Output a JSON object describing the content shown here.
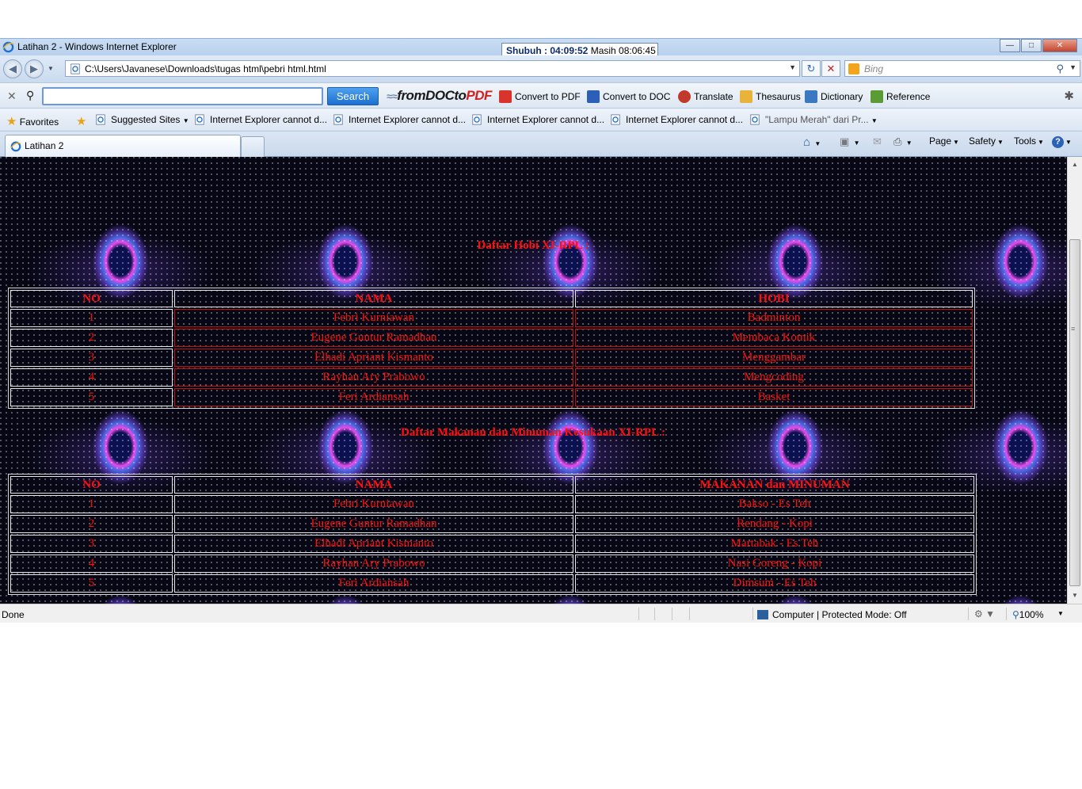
{
  "window": {
    "title": "Latihan 2 - Windows Internet Explorer",
    "clock_label": "Shubuh : 04:09:52",
    "clock_rest": "Masih 08:06:45"
  },
  "address": {
    "url": "C:\\Users\\Javanese\\Downloads\\tugas html\\pebri html.html",
    "search_placeholder": "Bing"
  },
  "toolbar": {
    "search_button": "Search",
    "brand_from": "from",
    "brand_doc": "DOC",
    "brand_to": "to",
    "brand_pdf": "PDF",
    "items": [
      "Convert to PDF",
      "Convert to DOC",
      "Translate",
      "Thesaurus",
      "Dictionary",
      "Reference"
    ]
  },
  "favorites": {
    "label": "Favorites",
    "items": [
      "Suggested Sites",
      "Internet Explorer cannot d...",
      "Internet Explorer cannot d...",
      "Internet Explorer cannot d...",
      "Internet Explorer cannot d...",
      "\"Lampu Merah\" dari Pr..."
    ]
  },
  "tabs": {
    "active": "Latihan 2"
  },
  "commands": [
    "Page",
    "Safety",
    "Tools"
  ],
  "page": {
    "heading1": "Daftar Hobi XI-RPL :",
    "table1": {
      "headers": [
        "NO",
        "NAMA",
        "HOBI"
      ],
      "rows": [
        [
          "1",
          "Febri Kurniawan",
          "Badminton"
        ],
        [
          "2",
          "Eugene Guntur Ramadhan",
          "Membaca Komik"
        ],
        [
          "3",
          "Elhadi Apriant Kismanto",
          "Menggambar"
        ],
        [
          "4",
          "Rayhan Ary Prabowo",
          "Mengcoding"
        ],
        [
          "5",
          "Feri Ardiansah",
          "Basket"
        ]
      ]
    },
    "heading2": "Daftar Makanan dan Minuman Kesukaan XI-RPL :",
    "table2": {
      "headers": [
        "NO",
        "NAMA",
        "MAKANAN dan MINUMAN"
      ],
      "rows": [
        [
          "1",
          "Febri Kurniawan",
          "Bakso - Es Teh"
        ],
        [
          "2",
          "Eugene Guntur Ramadhan",
          "Rendang - Kopi"
        ],
        [
          "3",
          "Elhadi Apriant Kismanto",
          "Martabak - Es Teh"
        ],
        [
          "4",
          "Rayhan Ary Prabowo",
          "Nasi Goreng - Kopi"
        ],
        [
          "5",
          "Feri Ardiansah",
          "Dimsum - Es Teh"
        ]
      ]
    }
  },
  "status": {
    "text": "Done",
    "zone": "Computer | Protected Mode: Off",
    "zoom": "100%"
  },
  "colors": {
    "table_text": "#ff1010",
    "titlebar": "#c9dcf2"
  }
}
